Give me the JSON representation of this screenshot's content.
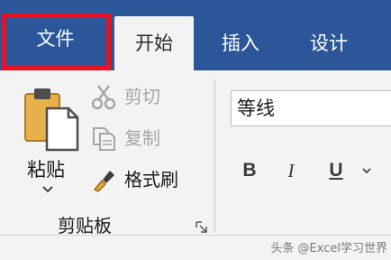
{
  "colors": {
    "tab_bar": "#2b579a",
    "ribbon": "#f3f3f3",
    "highlight": "#e81123",
    "disabled_text": "#a6a6a6"
  },
  "tabs": [
    {
      "label": "文件",
      "highlighted": true
    },
    {
      "label": "开始",
      "selected": true
    },
    {
      "label": "插入"
    },
    {
      "label": "设计"
    }
  ],
  "clipboard": {
    "paste_label": "粘贴",
    "cut_label": "剪切",
    "copy_label": "复制",
    "format_painter_label": "格式刷",
    "group_label": "剪贴板",
    "icons": [
      "clipboard-icon",
      "scissors-icon",
      "copy-icon",
      "paintbrush-icon",
      "dialog-launcher-icon"
    ]
  },
  "font": {
    "font_name": "等线",
    "bold_label": "B",
    "italic_label": "I",
    "underline_label": "U"
  },
  "watermark": {
    "text": "头条 @Excel学习世界"
  }
}
